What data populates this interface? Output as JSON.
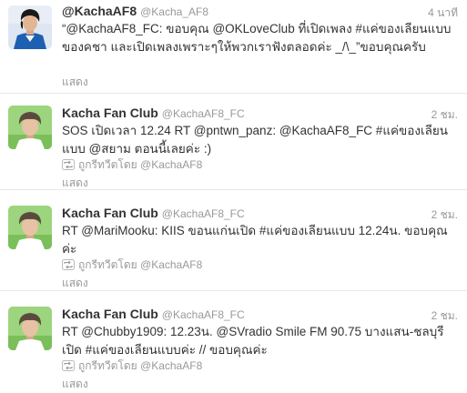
{
  "tweets": [
    {
      "display_name": "@KachaAF8",
      "handle": "@Kacha_AF8",
      "time": "4 นาที",
      "text": "“@KachaAF8_FC: ขอบคุณ @OKLoveClub ที่เปิดเพลง #แค่ของเลียนแบบ ของคชา และเปิดเพลงเพราะๆให้พวกเราฟังตลอดค่ะ _/\\_”ขอบคุณครับ",
      "retweeted_by": "",
      "expand": "แสดง"
    },
    {
      "display_name": "Kacha Fan Club",
      "handle": "@KachaAF8_FC",
      "time": "2 ชม.",
      "text": "SOS เปิดเวลา 12.24 RT @pntwn_panz: @KachaAF8_FC #แค่ของเลียนแบบ @สยาม ตอนนี้เลยค่ะ :)",
      "retweeted_by": "ถูกรีทวีตโดย @KachaAF8",
      "expand": "แสดง"
    },
    {
      "display_name": "Kacha Fan Club",
      "handle": "@KachaAF8_FC",
      "time": "2 ชม.",
      "text": "RT @MariMooku: KIIS ขอนแก่นเปิด #แค่ของเลียนแบบ 12.24น. ขอบคุณค่ะ",
      "retweeted_by": "ถูกรีทวีตโดย @KachaAF8",
      "expand": "แสดง"
    },
    {
      "display_name": "Kacha Fan Club",
      "handle": "@KachaAF8_FC",
      "time": "2 ชม.",
      "text": "RT @Chubby1909: 12.23น. @SVradio Smile FM 90.75 บางแสน-ชลบุรี เปิด #แค่ของเลียนแบบค่ะ // ขอบคุณค่ะ",
      "retweeted_by": "ถูกรีทวีตโดย @KachaAF8",
      "expand": "แสดง"
    }
  ]
}
